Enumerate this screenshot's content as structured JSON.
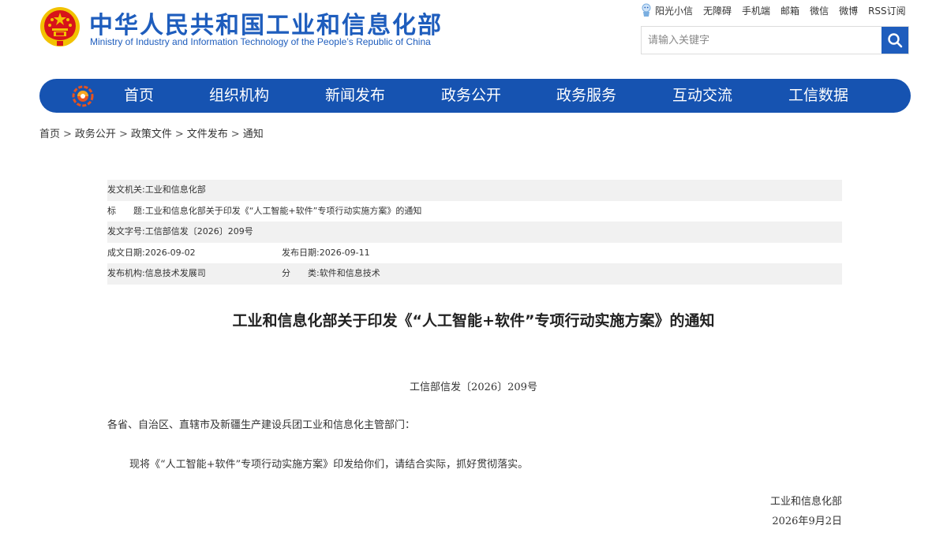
{
  "header": {
    "title_cn": "中华人民共和国工业和信息化部",
    "title_en": "Ministry of Industry and Information Technology of the People’s Republic of China",
    "top_links": [
      "阳光小信",
      "无障碍",
      "手机端",
      "邮箱",
      "微信",
      "微博",
      "RSS订阅"
    ],
    "search_placeholder": "请输入关键字"
  },
  "nav": {
    "items": [
      "首页",
      "组织机构",
      "新闻发布",
      "政务公开",
      "政务服务",
      "互动交流",
      "工信数据"
    ]
  },
  "breadcrumb": {
    "items": [
      "首页",
      "政务公开",
      "政策文件",
      "文件发布",
      "通知"
    ],
    "separator": ">"
  },
  "info": {
    "issuer_label": "发文机关:",
    "issuer": "工业和信息化部",
    "title_label": "标　　题:",
    "title": "工业和信息化部关于印发《“人工智能+软件”专项行动实施方案》的通知",
    "doc_no_label": "发文字号:",
    "doc_no": "工信部信发〔2026〕209号",
    "created_label": "成文日期:",
    "created": "2026-09-02",
    "published_label": "发布日期:",
    "published": "2026-09-11",
    "org_label": "发布机构:",
    "org": "信息技术发展司",
    "category_label": "分　　类:",
    "category": "软件和信息技术"
  },
  "article": {
    "title": "工业和信息化部关于印发《“人工智能+软件”专项行动实施方案》的通知",
    "doc_number": "工信部信发〔2026〕209号",
    "salutation": "各省、自治区、直辖市及新疆生产建设兵团工业和信息化主管部门：",
    "body": "现将《“人工智能+软件”专项行动实施方案》印发给你们，请结合实际，抓好贯彻落实。",
    "signature_org": "工业和信息化部",
    "signature_date": "2026年9月2日"
  },
  "colors": {
    "brand_blue": "#1e5dbd",
    "nav_blue": "#1653b1",
    "emblem_red": "#d7141a",
    "emblem_gold": "#f2c200",
    "row_shade": "#f1f1f1"
  }
}
